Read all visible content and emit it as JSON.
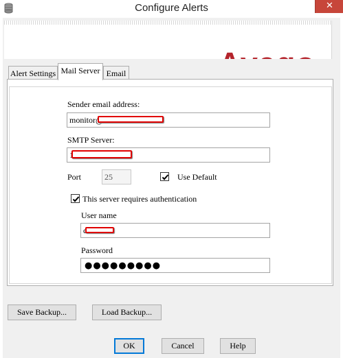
{
  "window": {
    "title": "Configure Alerts",
    "close_glyph": "✕",
    "icon": "database-icon"
  },
  "banner": {
    "logo_text": "Avago",
    "logo_color": "#b4242c"
  },
  "tabs": [
    {
      "label": "Alert Settings",
      "active": false
    },
    {
      "label": "Mail Server",
      "active": true
    },
    {
      "label": "Email",
      "active": false
    }
  ],
  "mail_server": {
    "sender_label": "Sender email address:",
    "sender_value": "monitor@",
    "smtp_label": "SMTP Server:",
    "smtp_value": "1",
    "port_label": "Port",
    "port_value": "25",
    "use_default_label": "Use Default",
    "use_default_checked": true,
    "auth_label": "This server requires authentication",
    "auth_checked": true,
    "username_label": "User name",
    "username_value": "c",
    "password_label": "Password",
    "password_value": "●●●●●●●●●"
  },
  "buttons": {
    "save_backup": "Save Backup...",
    "load_backup": "Load Backup...",
    "ok": "OK",
    "cancel": "Cancel",
    "help": "Help"
  }
}
